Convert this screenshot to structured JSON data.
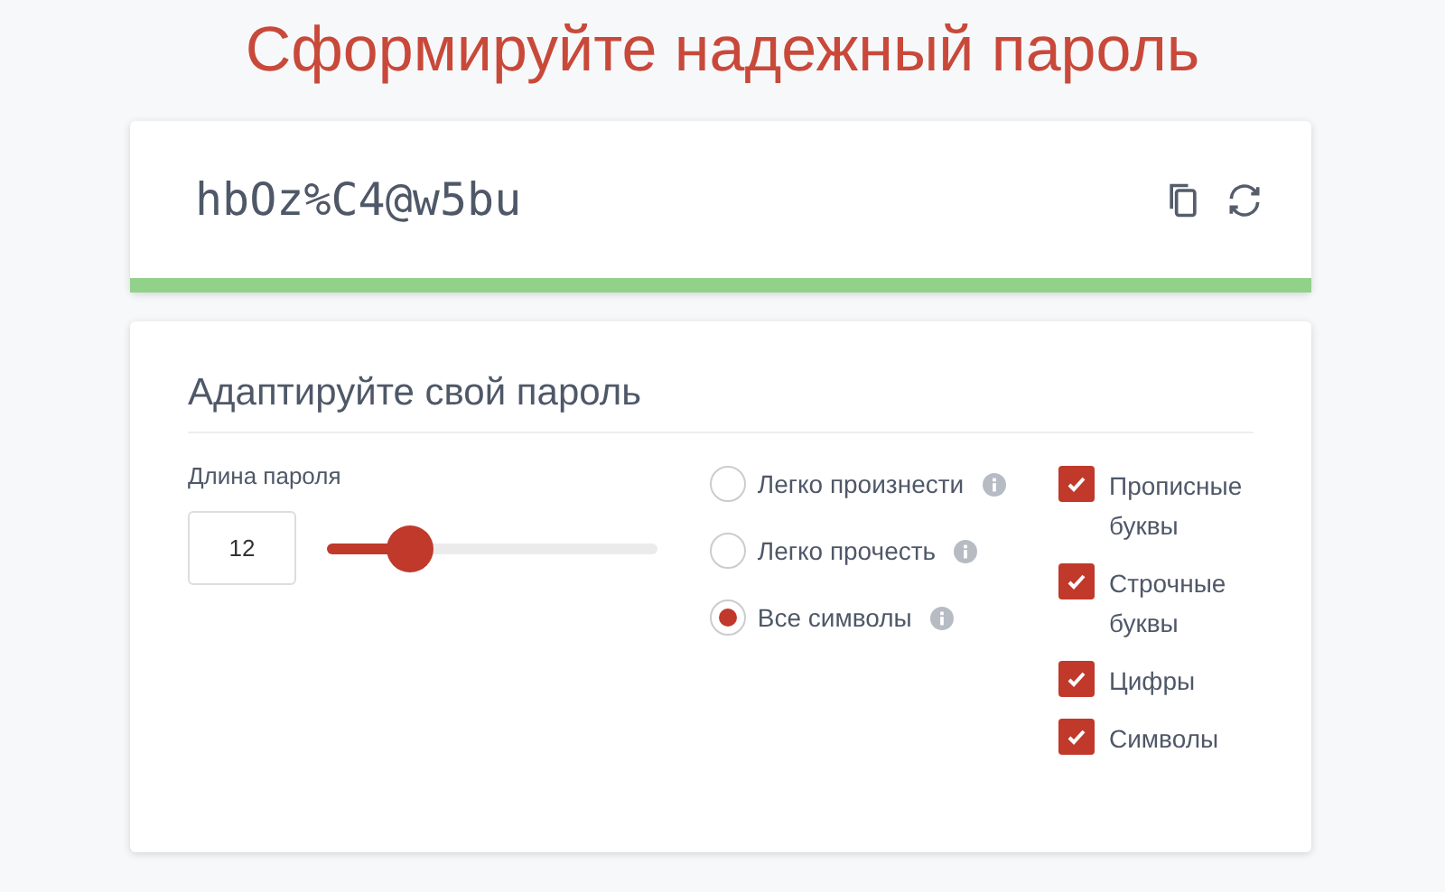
{
  "title": "Сформируйте надежный пароль",
  "password": {
    "value": "hbOz%C4@w5bu",
    "strength": {
      "level": 1
    }
  },
  "settings": {
    "heading": "Адаптируйте свой пароль",
    "length_label": "Длина пароля",
    "length_value": "12",
    "length_slider": {
      "level": 0.25
    },
    "modes": [
      {
        "label": "Легко произнести",
        "selected": false
      },
      {
        "label": "Легко прочесть",
        "selected": false
      },
      {
        "label": "Все символы",
        "selected": true
      }
    ],
    "options": [
      {
        "label": "Прописные буквы",
        "checked": true
      },
      {
        "label": "Строчные буквы",
        "checked": true
      },
      {
        "label": "Цифры",
        "checked": true
      },
      {
        "label": "Символы",
        "checked": true
      }
    ]
  }
}
